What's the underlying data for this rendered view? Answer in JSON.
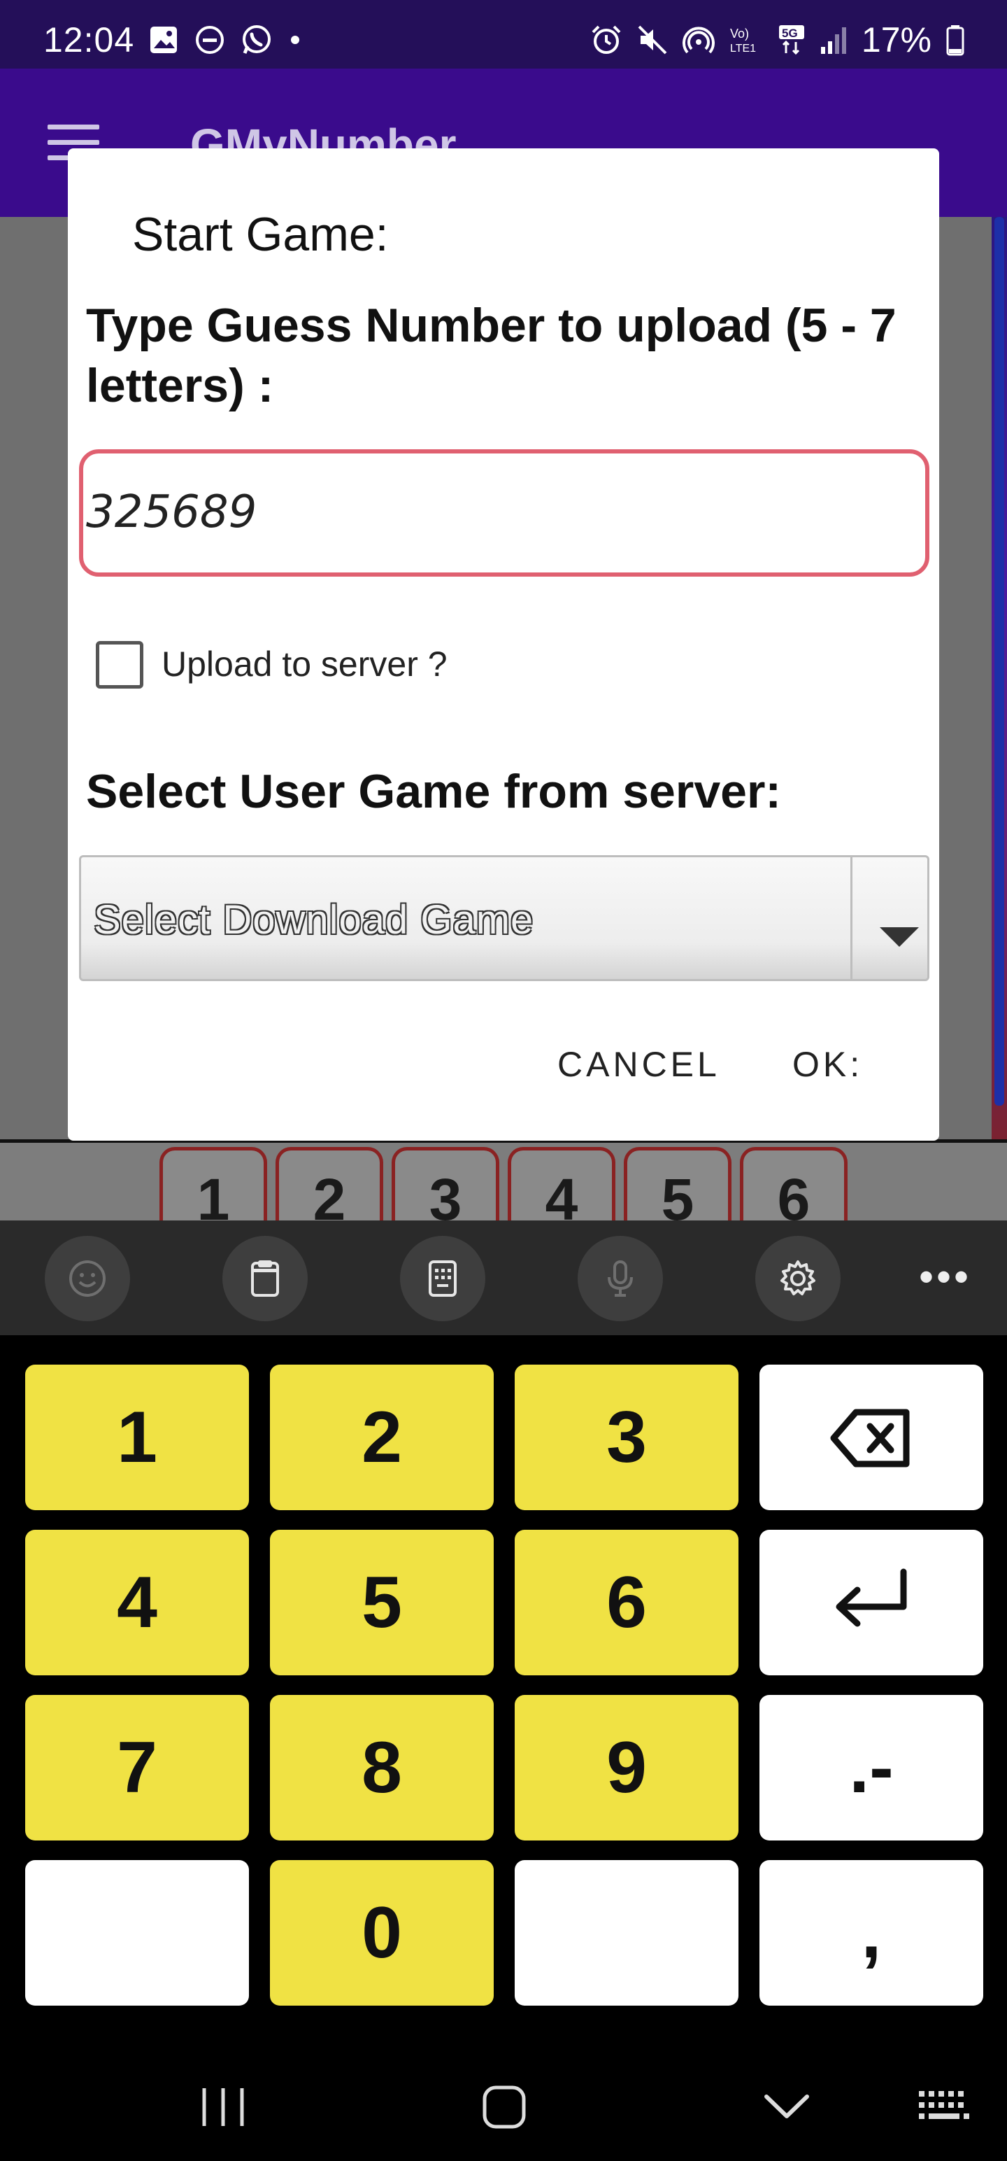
{
  "status_bar": {
    "time": "12:04",
    "battery_percent": "17%"
  },
  "app_bar": {
    "title": "GMyNumber"
  },
  "background": {
    "digit_cells": [
      "1",
      "2",
      "3",
      "4",
      "5",
      "6"
    ]
  },
  "dialog": {
    "title": "Start Game:",
    "guess_label": "Type Guess Number to upload (5 - 7 letters) :",
    "guess_value": "325689",
    "upload_checkbox_label": "Upload to server ?",
    "upload_checked": false,
    "select_label": "Select User Game from server:",
    "select_value": "Select Download Game",
    "cancel_label": "CANCEL",
    "ok_label": "OK:"
  },
  "keyboard": {
    "toolbar_icons": [
      "emoji-icon",
      "clipboard-icon",
      "keyboard-mode-icon",
      "microphone-icon",
      "settings-icon",
      "more-icon"
    ],
    "keys": [
      {
        "label": "1"
      },
      {
        "label": "2"
      },
      {
        "label": "3"
      },
      {
        "label": "backspace",
        "icon": "backspace-icon"
      },
      {
        "label": "4"
      },
      {
        "label": "5"
      },
      {
        "label": "6"
      },
      {
        "label": "enter",
        "icon": "enter-icon"
      },
      {
        "label": "7"
      },
      {
        "label": "8"
      },
      {
        "label": "9"
      },
      {
        "label": ".-"
      },
      {
        "label": ""
      },
      {
        "label": "0"
      },
      {
        "label": ""
      },
      {
        "label": ","
      }
    ],
    "key_color_yellow": "#f0e244"
  },
  "nav_bar": {
    "icons": [
      "recent-apps-icon",
      "home-icon",
      "back-icon",
      "keyboard-hide-icon"
    ]
  }
}
